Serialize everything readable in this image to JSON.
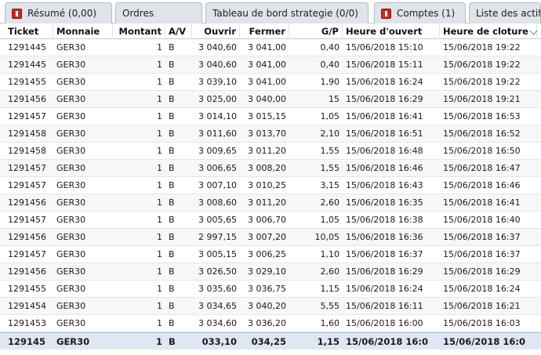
{
  "tabs": [
    {
      "label": "Résumé (0,00)",
      "has_close": true
    },
    {
      "label": "Ordres",
      "has_close": false
    },
    {
      "label": "Tableau de bord strategie (0/0)",
      "has_close": false
    },
    {
      "label": "Comptes (1)",
      "has_close": true
    },
    {
      "label": "Liste des actifs",
      "has_close": false
    }
  ],
  "columns": [
    "Ticket",
    "Monnaie",
    "Montant",
    "A/V",
    "Ouvrir",
    "Fermer",
    "G/P",
    "Heure d'ouvert",
    "Heure de cloture"
  ],
  "rows": [
    [
      "1291445",
      "GER30",
      "1",
      "B",
      "3 040,60",
      "3 041,00",
      "0,40",
      "15/06/2018 15:10",
      "15/06/2018 19:22"
    ],
    [
      "1291445",
      "GER30",
      "1",
      "B",
      "3 040,60",
      "3 041,00",
      "0,40",
      "15/06/2018 15:11",
      "15/06/2018 19:22"
    ],
    [
      "1291455",
      "GER30",
      "1",
      "B",
      "3 039,10",
      "3 041,00",
      "1,90",
      "15/06/2018 16:24",
      "15/06/2018 19:22"
    ],
    [
      "1291456",
      "GER30",
      "1",
      "B",
      "3 025,00",
      "3 040,00",
      "15",
      "15/06/2018 16:29",
      "15/06/2018 19:21"
    ],
    [
      "1291457",
      "GER30",
      "1",
      "B",
      "3 014,10",
      "3 015,15",
      "1,05",
      "15/06/2018 16:41",
      "15/06/2018 16:53"
    ],
    [
      "1291458",
      "GER30",
      "1",
      "B",
      "3 011,60",
      "3 013,70",
      "2,10",
      "15/06/2018 16:51",
      "15/06/2018 16:52"
    ],
    [
      "1291458",
      "GER30",
      "1",
      "B",
      "3 009,65",
      "3 011,20",
      "1,55",
      "15/06/2018 16:48",
      "15/06/2018 16:50"
    ],
    [
      "1291457",
      "GER30",
      "1",
      "B",
      "3 006,65",
      "3 008,20",
      "1,55",
      "15/06/2018 16:46",
      "15/06/2018 16:47"
    ],
    [
      "1291457",
      "GER30",
      "1",
      "B",
      "3 007,10",
      "3 010,25",
      "3,15",
      "15/06/2018 16:43",
      "15/06/2018 16:46"
    ],
    [
      "1291456",
      "GER30",
      "1",
      "B",
      "3 008,60",
      "3 011,20",
      "2,60",
      "15/06/2018 16:35",
      "15/06/2018 16:41"
    ],
    [
      "1291457",
      "GER30",
      "1",
      "B",
      "3 005,65",
      "3 006,70",
      "1,05",
      "15/06/2018 16:38",
      "15/06/2018 16:40"
    ],
    [
      "1291456",
      "GER30",
      "1",
      "B",
      "2 997,15",
      "3 007,20",
      "10,05",
      "15/06/2018 16:36",
      "15/06/2018 16:37"
    ],
    [
      "1291457",
      "GER30",
      "1",
      "B",
      "3 005,15",
      "3 006,25",
      "1,10",
      "15/06/2018 16:37",
      "15/06/2018 16:37"
    ],
    [
      "1291456",
      "GER30",
      "1",
      "B",
      "3 026,50",
      "3 029,10",
      "2,60",
      "15/06/2018 16:29",
      "15/06/2018 16:29"
    ],
    [
      "1291455",
      "GER30",
      "1",
      "B",
      "3 035,60",
      "3 036,75",
      "1,15",
      "15/06/2018 16:24",
      "15/06/2018 16:24"
    ],
    [
      "1291454",
      "GER30",
      "1",
      "B",
      "3 034,65",
      "3 040,20",
      "5,55",
      "15/06/2018 16:11",
      "15/06/2018 16:21"
    ],
    [
      "1291453",
      "GER30",
      "1",
      "B",
      "3 034,60",
      "3 036,20",
      "1,60",
      "15/06/2018 16:00",
      "15/06/2018 16:03"
    ],
    [
      "129145",
      "GER30",
      "1",
      "B",
      "033,10",
      "034,25",
      "1,15",
      "15/06/2018 16:0",
      "15/06/2018 16:0"
    ]
  ],
  "highlighted_row_index": 17,
  "icons": {
    "tab_close": "close-icon",
    "header_sort": "chevron-down-icon"
  },
  "colors": {
    "tab_close": "#c92a1e",
    "highlight_row": "#dfe7f5",
    "tab_bg": "#dfe4ea"
  }
}
